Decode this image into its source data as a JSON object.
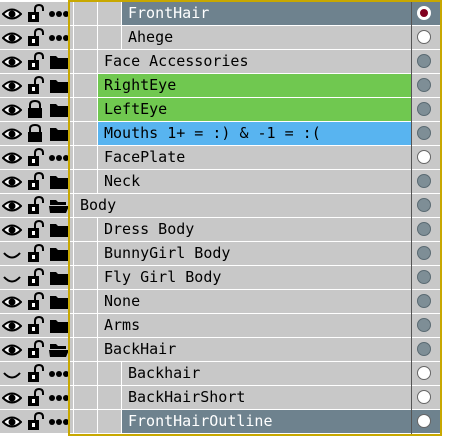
{
  "colors": {
    "normal": "#c8c8c8",
    "selected": "#6e828e",
    "green": "#70c850",
    "blue": "#58b4f0",
    "dot_on": "#ffffff",
    "dot_off": "#7e8e96",
    "dot_active": "#800020"
  },
  "layers": [
    {
      "name": "FrontHair",
      "indent": 2,
      "bg": "selected",
      "dot": "active",
      "eye": "eye-icon",
      "lock": "unlock-icon",
      "kind": "dots-icon"
    },
    {
      "name": "Ahege",
      "indent": 2,
      "bg": "normal",
      "dot": "on",
      "eye": "eye-icon",
      "lock": "unlock-icon",
      "kind": "dots-icon"
    },
    {
      "name": "Face Accessories",
      "indent": 1,
      "bg": "normal",
      "dot": "off",
      "eye": "eye-icon",
      "lock": "unlock-icon",
      "kind": "folder-icon"
    },
    {
      "name": "RightEye",
      "indent": 1,
      "bg": "green",
      "dot": "off",
      "eye": "eye-icon",
      "lock": "unlock-icon",
      "kind": "folder-icon"
    },
    {
      "name": "LeftEye",
      "indent": 1,
      "bg": "green",
      "dot": "off",
      "eye": "eye-icon",
      "lock": "lock-icon",
      "kind": "folder-icon"
    },
    {
      "name": "Mouths 1+ = :) & -1 = :(",
      "indent": 1,
      "bg": "blue",
      "dot": "off",
      "eye": "eye-icon",
      "lock": "lock-icon",
      "kind": "folder-icon"
    },
    {
      "name": "FacePlate",
      "indent": 1,
      "bg": "normal",
      "dot": "on",
      "eye": "eye-icon",
      "lock": "unlock-icon",
      "kind": "dots-icon"
    },
    {
      "name": "Neck",
      "indent": 1,
      "bg": "normal",
      "dot": "off",
      "eye": "eye-icon",
      "lock": "unlock-icon",
      "kind": "folder-icon"
    },
    {
      "name": "Body",
      "indent": 0,
      "bg": "normal",
      "dot": "off",
      "eye": "eye-icon",
      "lock": "unlock-icon",
      "kind": "open-folder-icon"
    },
    {
      "name": "Dress Body",
      "indent": 1,
      "bg": "normal",
      "dot": "off",
      "eye": "eye-icon",
      "lock": "unlock-icon",
      "kind": "folder-icon"
    },
    {
      "name": "BunnyGirl Body",
      "indent": 1,
      "bg": "normal",
      "dot": "off",
      "eye": "hidden-eye-icon",
      "lock": "unlock-icon",
      "kind": "folder-icon"
    },
    {
      "name": "Fly Girl Body",
      "indent": 1,
      "bg": "normal",
      "dot": "off",
      "eye": "hidden-eye-icon",
      "lock": "unlock-icon",
      "kind": "folder-icon"
    },
    {
      "name": "None",
      "indent": 1,
      "bg": "normal",
      "dot": "off",
      "eye": "eye-icon",
      "lock": "unlock-icon",
      "kind": "folder-icon"
    },
    {
      "name": "Arms",
      "indent": 1,
      "bg": "normal",
      "dot": "off",
      "eye": "eye-icon",
      "lock": "unlock-icon",
      "kind": "folder-icon"
    },
    {
      "name": "BackHair",
      "indent": 1,
      "bg": "normal",
      "dot": "off",
      "eye": "eye-icon",
      "lock": "unlock-icon",
      "kind": "open-folder-icon"
    },
    {
      "name": "Backhair",
      "indent": 2,
      "bg": "normal",
      "dot": "on",
      "eye": "hidden-eye-icon",
      "lock": "unlock-icon",
      "kind": "dots-icon"
    },
    {
      "name": "BackHairShort",
      "indent": 2,
      "bg": "normal",
      "dot": "on",
      "eye": "eye-icon",
      "lock": "unlock-icon",
      "kind": "dots-icon"
    },
    {
      "name": "FrontHairOutline",
      "indent": 2,
      "bg": "selected",
      "dot": "on",
      "eye": "eye-icon",
      "lock": "unlock-icon",
      "kind": "dots-icon"
    }
  ]
}
